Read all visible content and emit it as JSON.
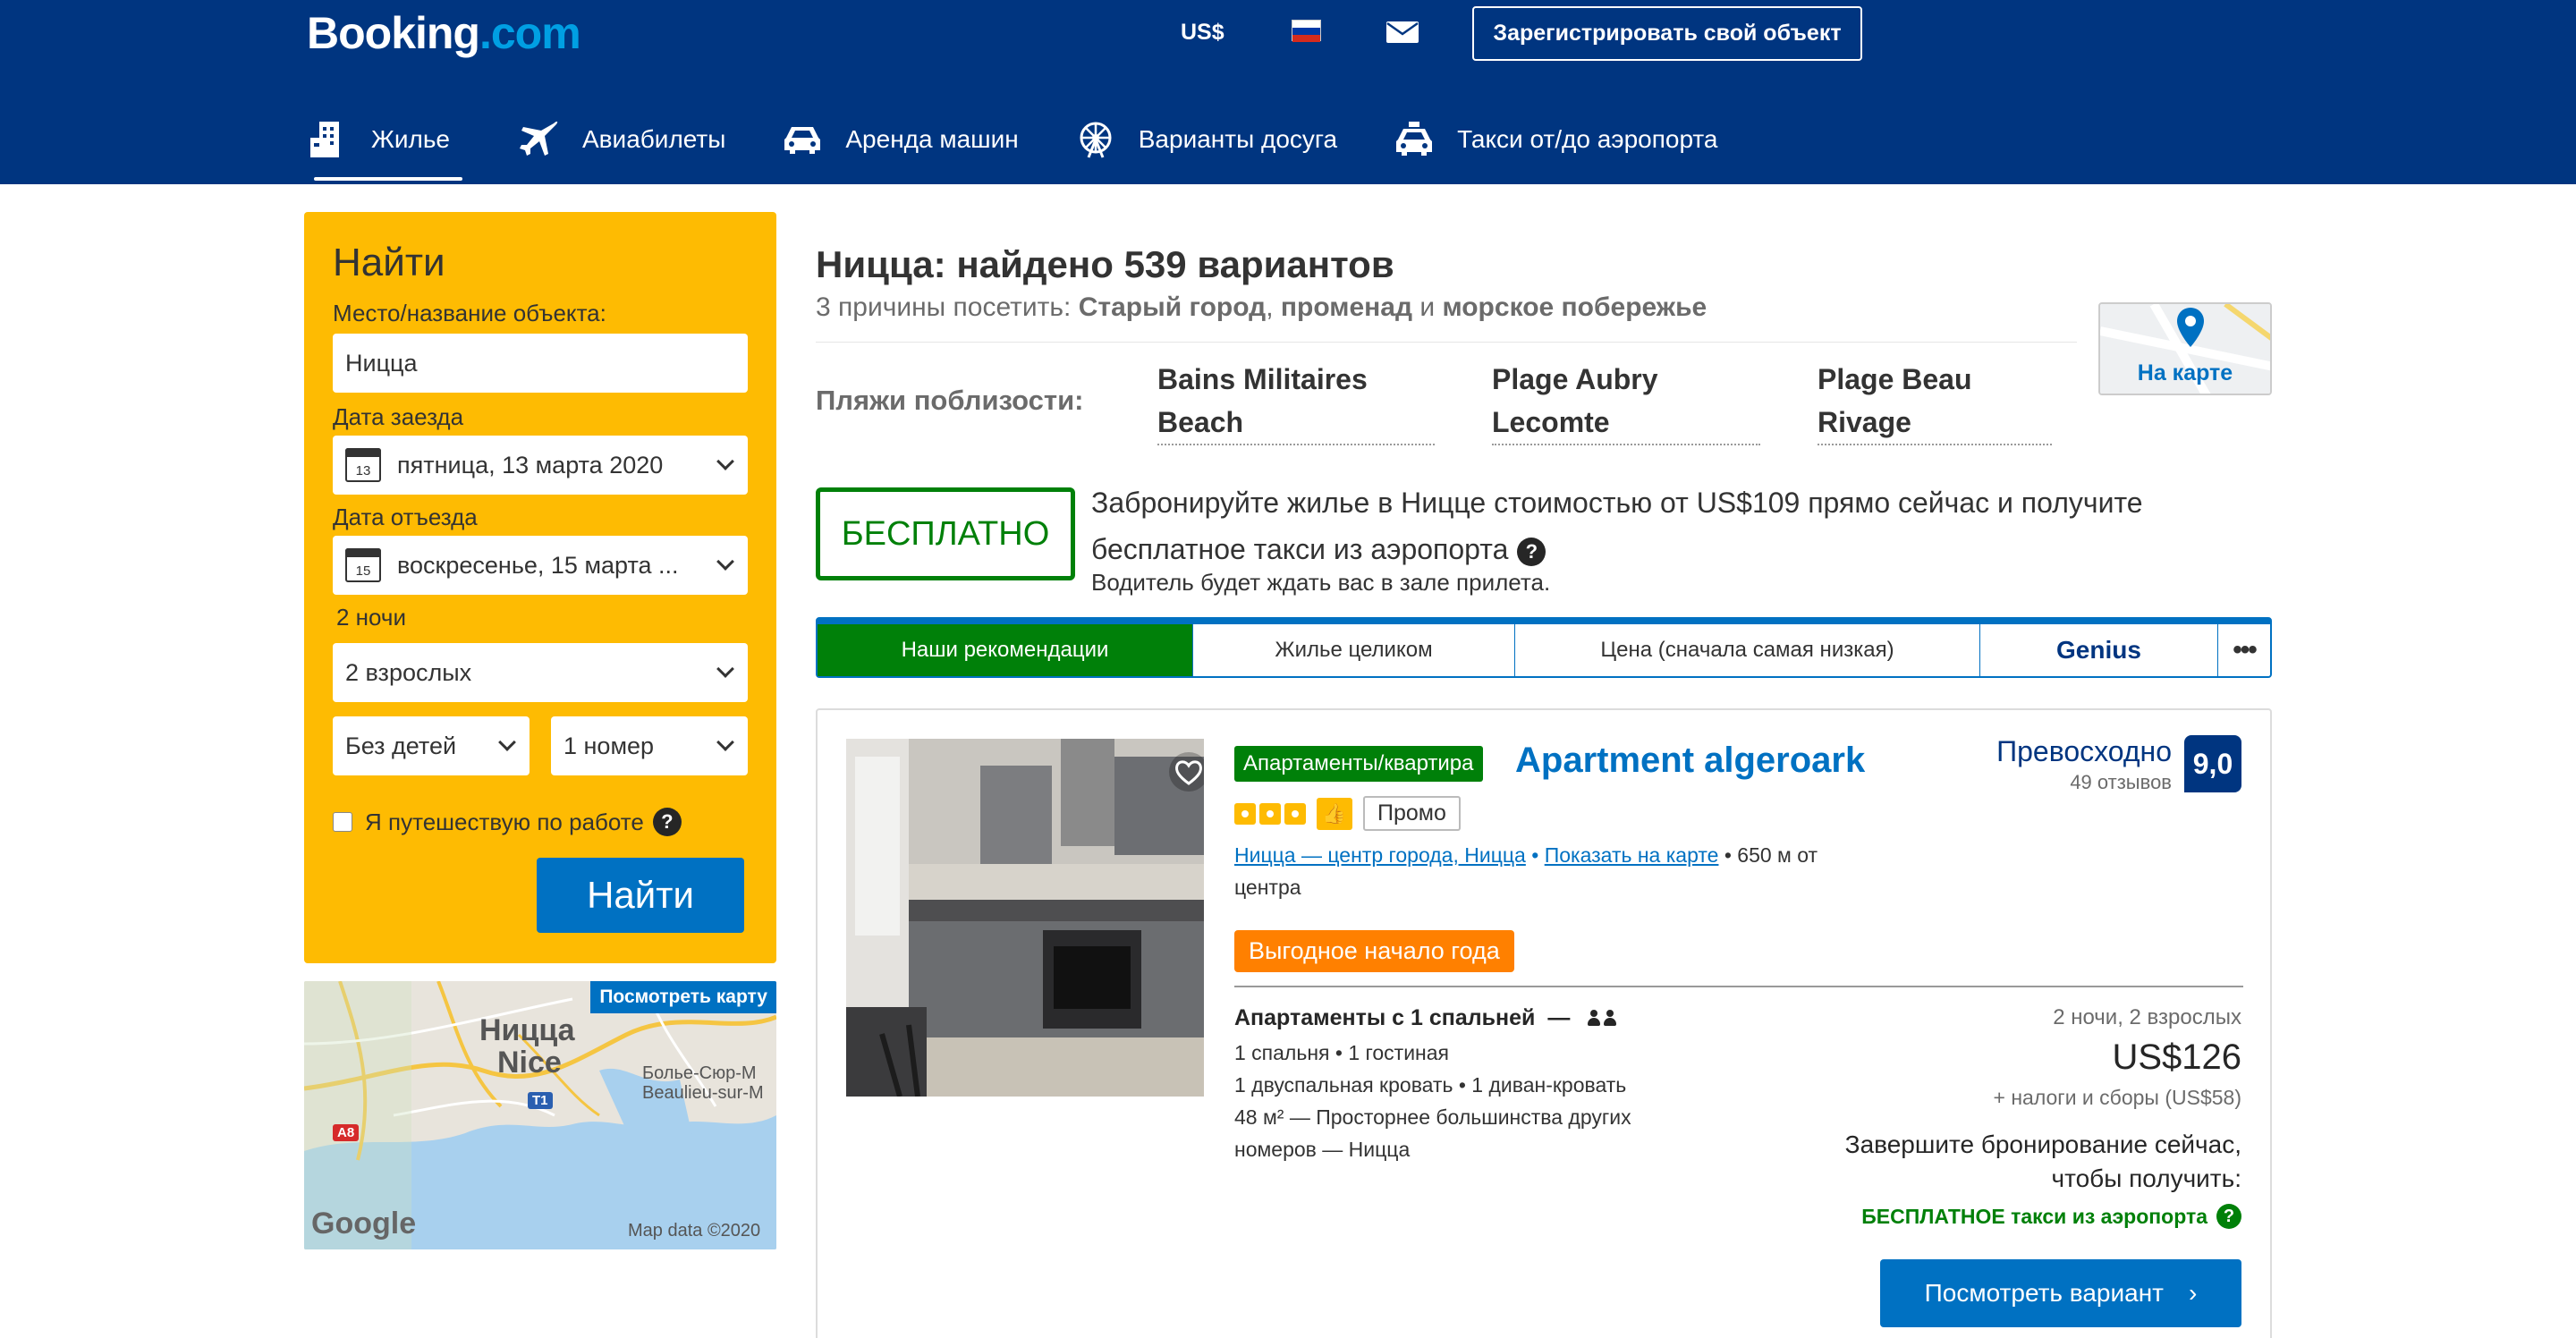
{
  "header": {
    "logo_main": "Booking",
    "logo_dot": ".com",
    "currency": "US$",
    "language_flag": "russia-flag",
    "register_label": "Зарегистрировать свой объект",
    "nav": [
      {
        "label": "Жилье",
        "icon": "bed-icon",
        "active": true
      },
      {
        "label": "Авиабилеты",
        "icon": "plane-icon",
        "active": false
      },
      {
        "label": "Аренда машин",
        "icon": "car-icon",
        "active": false
      },
      {
        "label": "Варианты досуга",
        "icon": "ferris-wheel-icon",
        "active": false
      },
      {
        "label": "Такси от/до аэропорта",
        "icon": "taxi-icon",
        "active": false
      }
    ]
  },
  "search": {
    "title": "Найти",
    "destination_label": "Место/название объекта:",
    "destination_value": "Ницца",
    "checkin_label": "Дата заезда",
    "checkin_day": "13",
    "checkin_value": "пятница, 13 марта 2020",
    "checkout_label": "Дата отъезда",
    "checkout_day": "15",
    "checkout_value": "воскресенье, 15 марта ...",
    "nights": "2 ночи",
    "adults": "2 взрослых",
    "children": "Без детей",
    "rooms": "1 номер",
    "work_trip": "Я путешествую по работе",
    "help": "?",
    "button": "Найти"
  },
  "map_thumb": {
    "button": "Посмотреть карту",
    "city_ru": "Ницца",
    "city_en": "Nice",
    "beaulieu_1": "Болье-Сюр-М",
    "beaulieu_2": "Beaulieu-sur-M",
    "road_a8": "A8",
    "road_t1": "T1",
    "google": "Google",
    "map_data": "Map data ©2020"
  },
  "results": {
    "title": "Ницца: найдено 539 вариантов",
    "reasons_prefix": "3 причины посетить: ",
    "reason_1": "Старый город",
    "reason_sep1": ", ",
    "reason_2": "променад",
    "reason_sep2": " и ",
    "reason_3": "морское побережье",
    "beaches_label": "Пляжи поблизости:",
    "beaches": [
      {
        "line1": "Bains Militaires",
        "line2": "Beach"
      },
      {
        "line1": "Plage Aubry",
        "line2": "Lecomte"
      },
      {
        "line1": "Plage Beau",
        "line2": "Rivage"
      }
    ],
    "map_label": "На карте",
    "free_badge": "БЕСПЛАТНО",
    "promo_line1": "Забронируйте жилье в Ницце стоимостью от US$109 прямо сейчас и получите",
    "promo_line2": "бесплатное такси из аэропорта",
    "promo_line3": "Водитель будет ждать вас в зале прилета.",
    "sort_tabs": [
      {
        "label": "Наши рекомендации",
        "active": true
      },
      {
        "label": "Жилье целиком",
        "active": false
      },
      {
        "label": "Цена (сначала самая низкая)",
        "active": false
      },
      {
        "label": "Genius",
        "active": false
      },
      {
        "label": "•••",
        "active": false
      }
    ]
  },
  "property": {
    "type": "Апартаменты/квартира",
    "name": "Apartment algeroark",
    "stars": 3,
    "promo_tag": "Промо",
    "thumb": "👍",
    "location_link": "Ницца — центр города, Ницца",
    "map_link": "Показать на карте",
    "distance": "650 м от центра",
    "distance_1": "650 м от",
    "distance_2": "центра",
    "deal": "Выгодное начало года",
    "score_label": "Превосходно",
    "reviews": "49 отзывов",
    "score": "9,0",
    "room_name": "Апартаменты с 1 спальней",
    "room_dash": "—",
    "room_line1": "1 спальня • 1 гостиная",
    "room_line2": "1 двуспальная кровать • 1 диван-кровать",
    "room_line3": "48 м² — Просторнее большинства других",
    "room_line4": "номеров — Ницца",
    "nights_info": "2 ночи, 2 взрослых",
    "price": "US$126",
    "taxes": "+ налоги и сборы (US$58)",
    "finish_1": "Завершите бронирование сейчас,",
    "finish_2": "чтобы получить:",
    "free_taxi": "БЕСПЛАТНОЕ такси из аэропорта",
    "view_button": "Посмотреть вариант",
    "view_arrow": "›"
  },
  "colors": {
    "brand_blue": "#003580",
    "link_blue": "#0071c2",
    "search_yellow": "#febb02",
    "green": "#008009",
    "orange": "#ff8000"
  }
}
